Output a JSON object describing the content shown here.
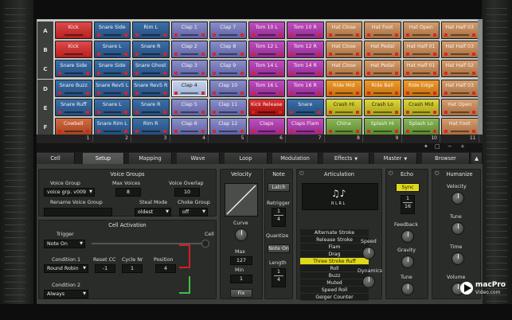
{
  "grid": {
    "rows": [
      {
        "label": "A",
        "pads": [
          {
            "name": "Kick",
            "color": "red"
          },
          {
            "name": "Snare Side",
            "color": "blue"
          },
          {
            "name": "Rim L",
            "color": "blue"
          },
          {
            "name": "Clap 1",
            "color": "periw"
          },
          {
            "name": "Clap 7",
            "color": "periw"
          },
          {
            "name": "Tom 10 L",
            "color": "mag"
          },
          {
            "name": "Tom 10 R",
            "color": "mag"
          },
          {
            "name": "Hat Close",
            "color": "tan"
          },
          {
            "name": "Hat Foot",
            "color": "tan"
          },
          {
            "name": "Hat Open",
            "color": "tan"
          },
          {
            "name": "Hat Half 03",
            "color": "tan"
          }
        ]
      },
      {
        "label": "B",
        "pads": [
          {
            "name": "Kick",
            "color": "red"
          },
          {
            "name": "Snare L",
            "color": "blue"
          },
          {
            "name": "Snare R",
            "color": "blue"
          },
          {
            "name": "Clap 2",
            "color": "periw"
          },
          {
            "name": "Clap 8",
            "color": "periw"
          },
          {
            "name": "Tom 12 L",
            "color": "mag"
          },
          {
            "name": "Tom 12 R",
            "color": "mag"
          },
          {
            "name": "Hat Close",
            "color": "tan"
          },
          {
            "name": "Hat Pedal",
            "color": "tan"
          },
          {
            "name": "Hat Half 01",
            "color": "tan"
          },
          {
            "name": "Hat Half 03",
            "color": "tan"
          }
        ]
      },
      {
        "label": "C",
        "pads": [
          {
            "name": "Snare Side",
            "color": "blue"
          },
          {
            "name": "Snare Side",
            "color": "blue"
          },
          {
            "name": "Snare Ghost",
            "color": "blue"
          },
          {
            "name": "Clap 3",
            "color": "periw"
          },
          {
            "name": "Clap 9",
            "color": "periw"
          },
          {
            "name": "Tom 14 L",
            "color": "mag"
          },
          {
            "name": "Tom 14 R",
            "color": "mag"
          },
          {
            "name": "Hat Close",
            "color": "tan"
          },
          {
            "name": "Hat Pedal",
            "color": "tan"
          },
          {
            "name": "Hat Half 01",
            "color": "tan"
          },
          {
            "name": "Hat Half 02",
            "color": "tan"
          }
        ]
      },
      {
        "label": "D",
        "pads": [
          {
            "name": "Snare Buzz",
            "color": "blue"
          },
          {
            "name": "Snare RevS L",
            "color": "blue"
          },
          {
            "name": "Snare RevS R",
            "color": "blue"
          },
          {
            "name": "Clap 4",
            "color": "lblue"
          },
          {
            "name": "Clap 10",
            "color": "periw"
          },
          {
            "name": "Tom 16 L",
            "color": "mag"
          },
          {
            "name": "Tom 16 R",
            "color": "mag"
          },
          {
            "name": "Ride Mid",
            "color": "orange"
          },
          {
            "name": "Ride Bell",
            "color": "orange"
          },
          {
            "name": "Ride Edge",
            "color": "orange"
          },
          {
            "name": "Hat Half 03",
            "color": "tan"
          }
        ]
      },
      {
        "label": "E",
        "pads": [
          {
            "name": "Snare Ruff",
            "color": "blue"
          },
          {
            "name": "Snare L",
            "color": "blue"
          },
          {
            "name": "Snare R",
            "color": "blue"
          },
          {
            "name": "Clap 5",
            "color": "periw"
          },
          {
            "name": "Clap 11",
            "color": "periw"
          },
          {
            "name": "Kick Release",
            "color": "redd"
          },
          {
            "name": "Snare",
            "color": "blue"
          },
          {
            "name": "Crash Hi",
            "color": "yellow"
          },
          {
            "name": "Crash Lo",
            "color": "yellow"
          },
          {
            "name": "Crash Mid",
            "color": "yellow"
          },
          {
            "name": "Hat Open",
            "color": "tan"
          }
        ]
      },
      {
        "label": "F",
        "pads": [
          {
            "name": "Cowbell",
            "color": "copper"
          },
          {
            "name": "Snare Rim L",
            "color": "blue"
          },
          {
            "name": "Rim R",
            "color": "blue"
          },
          {
            "name": "Clap 6",
            "color": "periw"
          },
          {
            "name": "Clap 12",
            "color": "periw"
          },
          {
            "name": "Claps",
            "color": "mag"
          },
          {
            "name": "Claps Flam",
            "color": "mag"
          },
          {
            "name": "China",
            "color": "green"
          },
          {
            "name": "Splash Hi",
            "color": "green"
          },
          {
            "name": "Splash Lo",
            "color": "green"
          },
          {
            "name": "Hat Foot",
            "color": "tan"
          }
        ]
      }
    ],
    "columns": [
      "1",
      "2",
      "3",
      "4",
      "5",
      "6",
      "7",
      "8",
      "9",
      "10",
      "11"
    ],
    "selected_pad": {
      "row": 3,
      "col": 3
    }
  },
  "controls": {
    "items": [
      "✦",
      "□",
      "−",
      "+"
    ]
  },
  "tabs": [
    {
      "label": "Cell",
      "active": false
    },
    {
      "label": "Setup",
      "active": true
    },
    {
      "label": "Mapping",
      "active": false
    },
    {
      "label": "Wave",
      "active": false
    },
    {
      "label": "Loop",
      "active": false
    },
    {
      "label": "Modulation",
      "active": false
    },
    {
      "label": "Effects",
      "active": false,
      "dropdown": true
    },
    {
      "label": "Master",
      "active": false,
      "dropdown": true
    },
    {
      "label": "Browser",
      "active": false
    }
  ],
  "voice_groups": {
    "title": "Voice Groups",
    "voice_group_label": "Voice Group",
    "voice_group_value": "voice grp. v009",
    "max_voices_label": "Max Voices",
    "max_voices_value": "8",
    "voice_overlap_label": "Voice Overlap",
    "voice_overlap_value": "10",
    "rename_label": "Rename Voice Group",
    "steal_mode_label": "Steal Mode",
    "steal_mode_value": "oldest",
    "choke_group_label": "Choke Group",
    "choke_group_value": "off"
  },
  "cell_activation": {
    "title": "Cell Activation",
    "trigger_label": "Trigger",
    "trigger_value": "Note On",
    "cell_label": "Cell",
    "condition1_label": "Condition 1",
    "condition1_value": "Round Robin",
    "reset_cc_label": "Reset CC",
    "reset_cc_value": "-1",
    "cycle_nr_label": "Cycle Nr",
    "cycle_nr_value": "1",
    "position_label": "Position",
    "position_value": "4",
    "condition2_label": "Condition 2",
    "condition2_value": "Always"
  },
  "velocity": {
    "title": "Velocity",
    "curve_label": "Curve",
    "max_label": "Max",
    "max_value": "127",
    "min_label": "Min",
    "min_value": "1",
    "fix_label": "Fix"
  },
  "note": {
    "title": "Note",
    "latch_label": "Latch",
    "retrigger_label": "Retrigger",
    "retrigger_num": "1",
    "retrigger_den": "4",
    "quantize_label": "Quantize",
    "note_on_label": "Note On",
    "length_label": "Length",
    "length_num": "1",
    "length_den": "4"
  },
  "articulation": {
    "title": "Articulation",
    "notation_caption": "R L R L",
    "items": [
      "Alternate Stroke",
      "Release Stroke",
      "Flam",
      "Drag",
      "Three Stroke Ruff",
      "Roll",
      "Buzz",
      "Muted",
      "Speed Roll",
      "Geiger Counter"
    ],
    "selected": "Three Stroke Ruff",
    "speed_label": "Speed",
    "dynamics_label": "Dynamics"
  },
  "echo": {
    "title": "Echo",
    "sync_label": "Sync",
    "sync_num": "1",
    "sync_den": "16",
    "feedback_label": "Feedback",
    "gravity_label": "Gravity",
    "tune_label": "Tune"
  },
  "humanize": {
    "title": "Humanize",
    "velocity_label": "Velocity",
    "tune_label": "Tune",
    "time_label": "Time",
    "volume_label": "Volume"
  },
  "logo": {
    "line1": "macPro",
    "line2": "Video.com"
  },
  "colors": {
    "selected_item": "#e0d81a",
    "sync": "#e0d81a",
    "accent_red": "#d42020",
    "accent_green": "#40c040"
  }
}
